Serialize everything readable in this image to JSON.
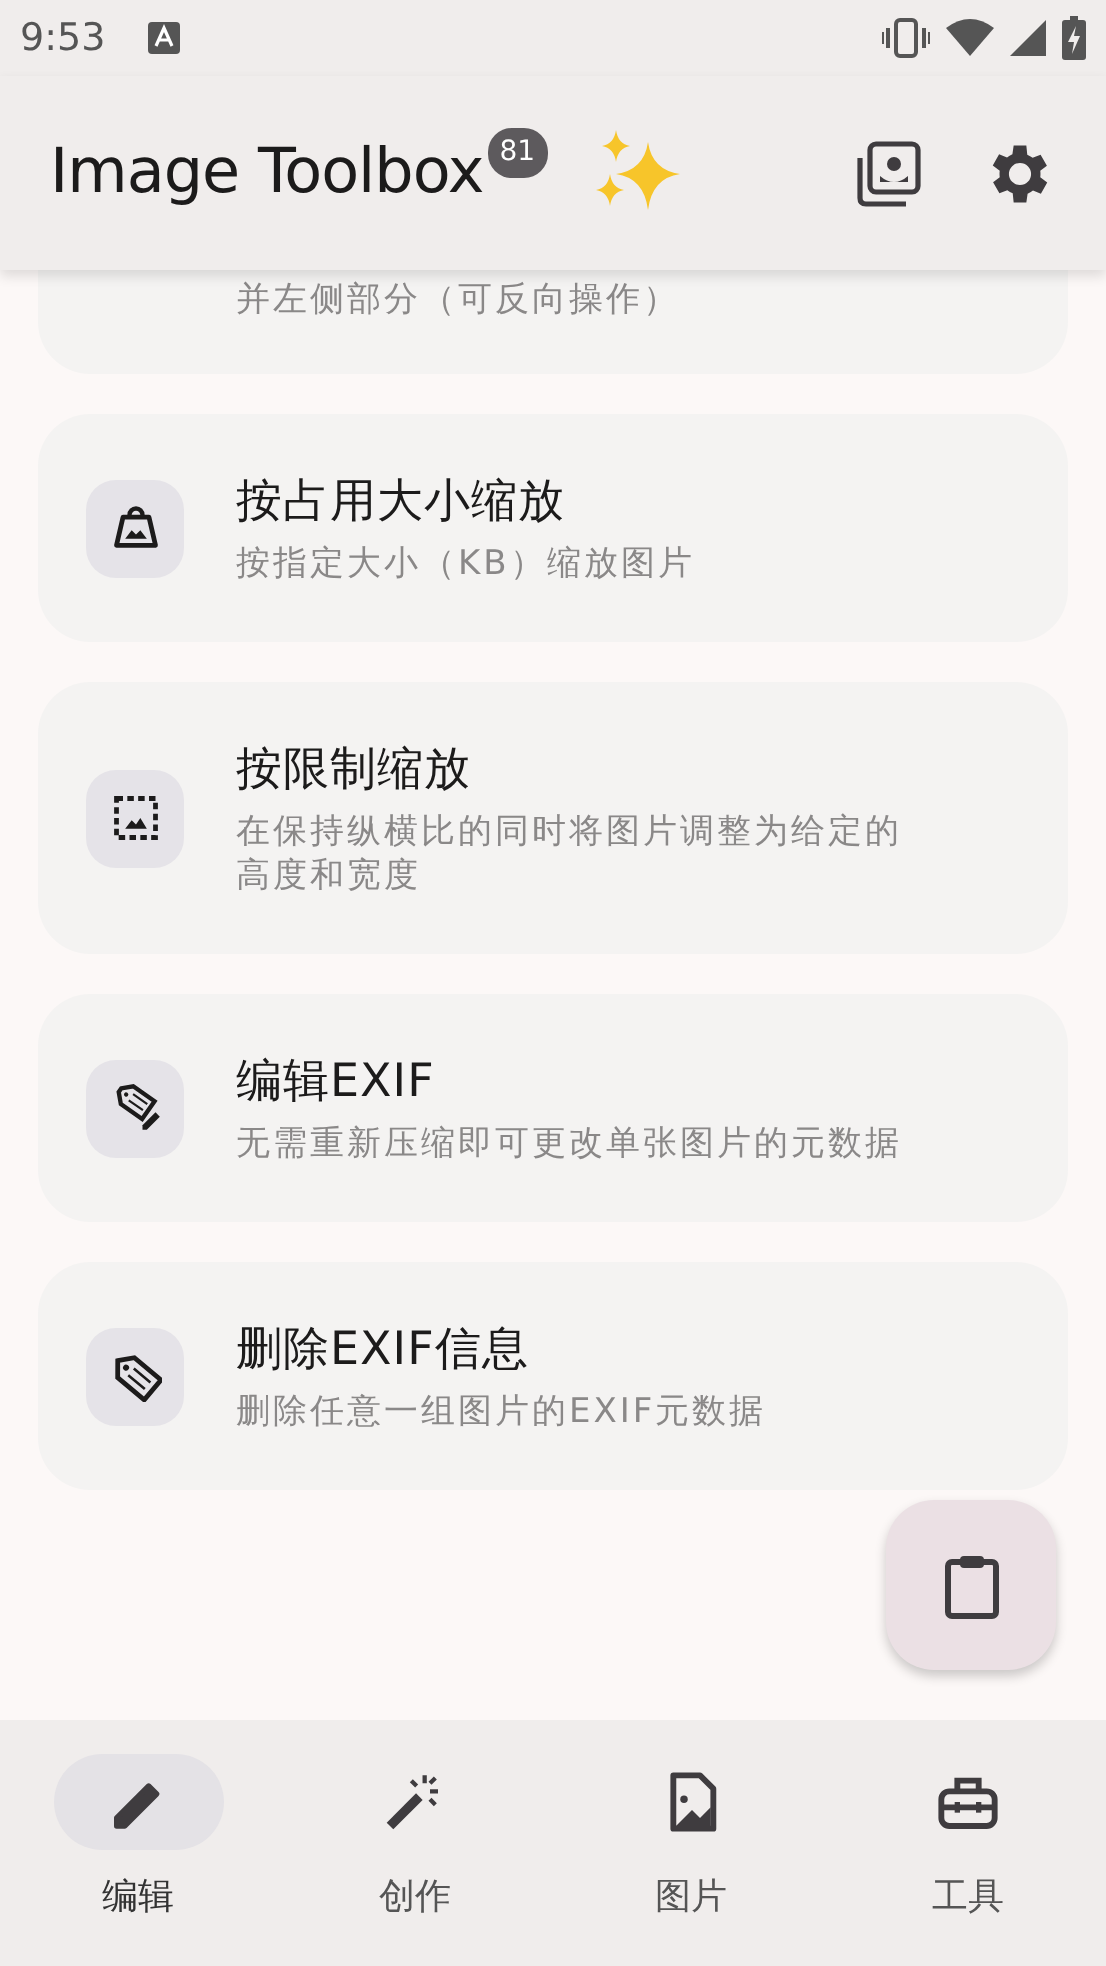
{
  "status_bar": {
    "time": "9:53"
  },
  "app_bar": {
    "title": "Image Toolbox",
    "badge": "81"
  },
  "tools": [
    {
      "kind": "cut",
      "subtitle": "并左侧部分（可反向操作）"
    },
    {
      "kind": "weight",
      "title": "按占用大小缩放",
      "subtitle": "按指定大小（KB）缩放图片"
    },
    {
      "kind": "limits",
      "title": "按限制缩放",
      "subtitle": "在保持纵横比的同时将图片调整为给定的高度和宽度"
    },
    {
      "kind": "exif-edit",
      "title": "编辑EXIF",
      "subtitle": "无需重新压缩即可更改单张图片的元数据"
    },
    {
      "kind": "exif-delete",
      "title": "删除EXIF信息",
      "subtitle": "删除任意一组图片的EXIF元数据"
    }
  ],
  "bottom_nav": [
    {
      "kind": "edit",
      "label": "编辑",
      "selected": true
    },
    {
      "kind": "create",
      "label": "创作",
      "selected": false
    },
    {
      "kind": "image",
      "label": "图片",
      "selected": false
    },
    {
      "kind": "tools",
      "label": "工具",
      "selected": false
    }
  ]
}
